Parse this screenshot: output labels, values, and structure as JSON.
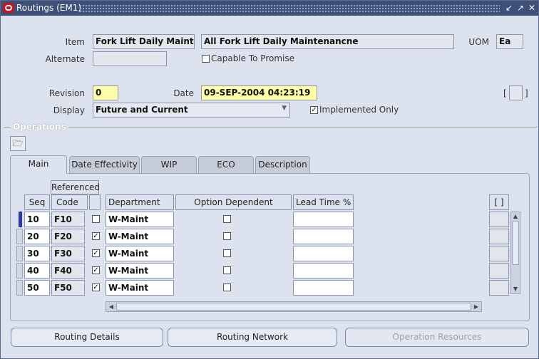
{
  "window": {
    "title": "Routings (EM1)"
  },
  "header": {
    "item_label": "Item",
    "item_value": "Fork Lift Daily Mainter",
    "item_desc": "All Fork Lift Daily Maintenancne",
    "uom_label": "UOM",
    "uom_value": "Ea",
    "alternate_label": "Alternate",
    "alternate_value": "",
    "ctp_label": "Capable To Promise",
    "ctp_checked": false,
    "revision_label": "Revision",
    "revision_value": "0",
    "date_label": "Date",
    "date_value": "09-SEP-2004 04:23:19",
    "display_label": "Display",
    "display_value": "Future and Current",
    "implemented_label": "Implemented Only",
    "implemented_checked": true,
    "bracket_open": "[",
    "bracket_close": "]"
  },
  "operations": {
    "section_title": "Operations",
    "tabs": [
      "Main",
      "Date Effectivity",
      "WIP",
      "ECO",
      "Description"
    ],
    "active_tab": "Main",
    "columns": {
      "referenced": "Referenced",
      "seq": "Seq",
      "code": "Code",
      "department": "Department",
      "option_dependent": "Option Dependent",
      "lead_time": "Lead Time %",
      "dff": "[ ]"
    },
    "rows": [
      {
        "seq": "10",
        "code": "F10",
        "referenced": false,
        "department": "W-Maint",
        "option_dependent": false,
        "lead_time": ""
      },
      {
        "seq": "20",
        "code": "F20",
        "referenced": true,
        "department": "W-Maint",
        "option_dependent": false,
        "lead_time": ""
      },
      {
        "seq": "30",
        "code": "F30",
        "referenced": true,
        "department": "W-Maint",
        "option_dependent": false,
        "lead_time": ""
      },
      {
        "seq": "40",
        "code": "F40",
        "referenced": true,
        "department": "W-Maint",
        "option_dependent": false,
        "lead_time": ""
      },
      {
        "seq": "50",
        "code": "F50",
        "referenced": true,
        "department": "W-Maint",
        "option_dependent": false,
        "lead_time": ""
      }
    ]
  },
  "buttons": {
    "routing_details": "Routing Details",
    "routing_network": "Routing Network",
    "operation_resources": "Operation Resources"
  }
}
